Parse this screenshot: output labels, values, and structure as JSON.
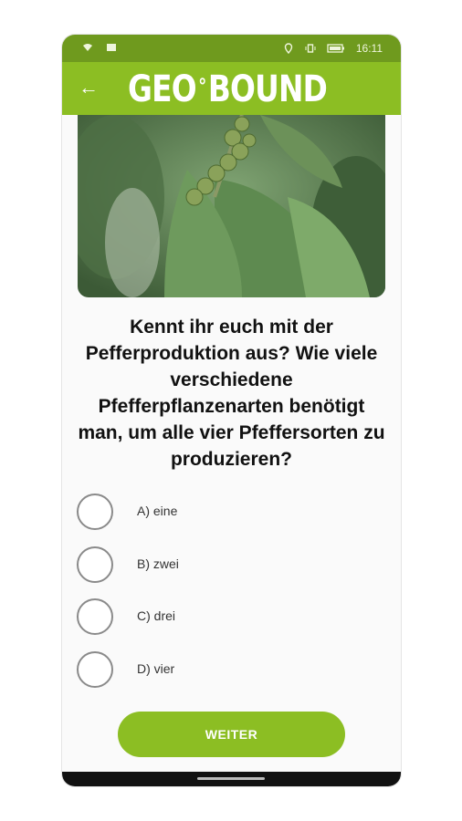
{
  "statusbar": {
    "time": "16:11"
  },
  "appbar": {
    "logo_left": "GEO",
    "logo_degree": "°",
    "logo_right": "BOUND",
    "back_icon": "←"
  },
  "question": "Kennt ihr euch mit der Pefferproduktion aus? Wie viele verschiedene Pfefferpflanzenarten benötigt man, um alle vier Pfeffersorten zu produzieren?",
  "options": [
    {
      "label": "A) eine"
    },
    {
      "label": "B) zwei"
    },
    {
      "label": "C) drei"
    },
    {
      "label": "D) vier"
    }
  ],
  "button": {
    "label": "WEITER"
  },
  "colors": {
    "accent": "#8cbe23",
    "status": "#6f9a1e"
  }
}
